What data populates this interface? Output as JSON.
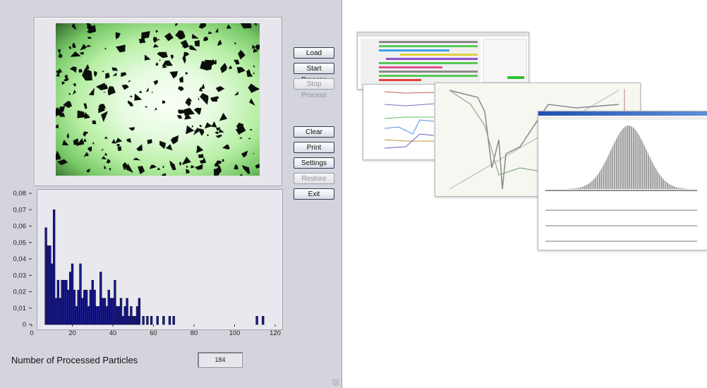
{
  "buttons": {
    "load": "Load",
    "start_process": "Start Process",
    "stop_process": "Stop Process",
    "clear": "Clear",
    "print": "Print",
    "settings": "Settings",
    "restore": "Restore",
    "exit": "Exit"
  },
  "count": {
    "label": "Number of Processed Particles",
    "value": "184"
  },
  "colors": {
    "panel_bg": "#d4d4dc",
    "bar_fill": "#1c1c8c",
    "bar_stroke": "#000033"
  },
  "chart_data": {
    "type": "bar",
    "xticks": [
      "0",
      "20",
      "40",
      "60",
      "80",
      "100",
      "120"
    ],
    "yticks": [
      "0",
      "0,01",
      "0,02",
      "0,03",
      "0,04",
      "0,05",
      "0,06",
      "0,07",
      "0,08"
    ],
    "xlim": [
      0,
      120
    ],
    "ylim": [
      0,
      0.08
    ],
    "x": [
      7,
      8,
      9,
      10,
      11,
      12,
      13,
      14,
      15,
      16,
      17,
      18,
      19,
      20,
      21,
      22,
      23,
      24,
      25,
      26,
      27,
      28,
      29,
      30,
      31,
      32,
      33,
      34,
      35,
      36,
      37,
      38,
      39,
      40,
      41,
      42,
      43,
      44,
      45,
      46,
      47,
      48,
      49,
      50,
      51,
      52,
      53,
      55,
      57,
      59,
      62,
      65,
      68,
      70,
      111,
      114
    ],
    "values": [
      0.059,
      0.048,
      0.048,
      0.037,
      0.07,
      0.016,
      0.027,
      0.016,
      0.027,
      0.027,
      0.027,
      0.021,
      0.032,
      0.037,
      0.021,
      0.011,
      0.021,
      0.037,
      0.016,
      0.021,
      0.021,
      0.011,
      0.021,
      0.027,
      0.021,
      0.011,
      0.011,
      0.032,
      0.016,
      0.016,
      0.011,
      0.021,
      0.016,
      0.016,
      0.027,
      0.011,
      0.011,
      0.016,
      0.005,
      0.011,
      0.016,
      0.005,
      0.011,
      0.005,
      0.005,
      0.011,
      0.016,
      0.005,
      0.005,
      0.005,
      0.005,
      0.005,
      0.005,
      0.005,
      0.005,
      0.005
    ]
  }
}
